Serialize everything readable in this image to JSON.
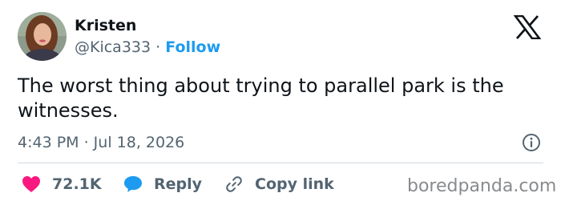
{
  "author": {
    "name": "Kristen",
    "handle": "@Kica333",
    "separator": "·",
    "follow_label": "Follow"
  },
  "tweet": {
    "text": "The worst thing about trying to parallel park is the witnesses.",
    "timestamp": "4:43 PM · Jul 18, 2026"
  },
  "actions": {
    "like_count": "72.1K",
    "reply_label": "Reply",
    "copy_link_label": "Copy link"
  },
  "watermark": "boredpanda.com",
  "icons": {
    "logo": "x-logo-icon",
    "info": "info-icon",
    "like": "heart-icon",
    "reply": "speech-bubble-icon",
    "copy": "link-icon"
  },
  "colors": {
    "accent": "#1d9bf0",
    "like": "#f91880",
    "text": "#0f1419",
    "secondary": "#536471",
    "divider": "#cfd9de"
  }
}
